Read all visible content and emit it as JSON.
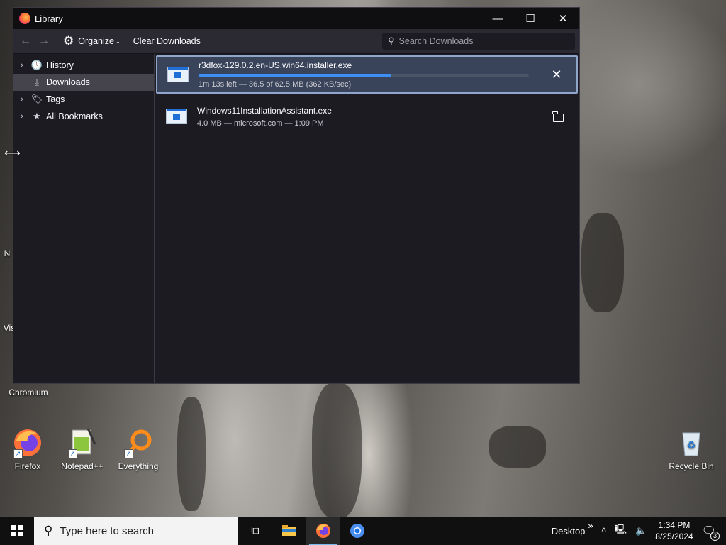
{
  "window": {
    "title": "Library",
    "controls": {
      "minimize": "—",
      "maximize": "☐",
      "close": "✕"
    }
  },
  "toolbar": {
    "back": "←",
    "forward": "→",
    "organize_label": "Organize",
    "organize_caret": "⌄",
    "clear_label": "Clear Downloads",
    "search_placeholder": "Search Downloads"
  },
  "sidebar": {
    "items": [
      {
        "label": "History",
        "twisty": "›",
        "icon": "history-icon",
        "selected": false
      },
      {
        "label": "Downloads",
        "twisty": "",
        "icon": "download-icon",
        "selected": true
      },
      {
        "label": "Tags",
        "twisty": "›",
        "icon": "tags-icon",
        "selected": false
      },
      {
        "label": "All Bookmarks",
        "twisty": "›",
        "icon": "star-icon",
        "selected": false
      }
    ]
  },
  "downloads": [
    {
      "name": "r3dfox-129.0.2.en-US.win64.installer.exe",
      "status": "1m 13s left — 36.5 of 62.5 MB (362 KB/sec)",
      "progress": 0.584,
      "action": "cancel",
      "action_glyph": "✕"
    },
    {
      "name": "Windows11InstallationAssistant.exe",
      "status": "4.0 MB — microsoft.com — 1:09 PM",
      "action": "open-folder"
    }
  ],
  "desktop_icons": {
    "chromium": "Chromium",
    "firefox": "Firefox",
    "notepadpp": "Notepad++",
    "everything": "Everything",
    "recycle": "Recycle Bin",
    "partial_1": "N",
    "partial_2": "Vis"
  },
  "taskbar": {
    "search_placeholder": "Type here to search",
    "desktop_label": "Desktop",
    "overflow": "»",
    "time": "1:34 PM",
    "date": "8/25/2024",
    "notification_count": "3"
  },
  "colors": {
    "window_bg": "#1c1b22",
    "toolbar_bg": "#2b2a33",
    "progress": "#3d8ef5",
    "active_row": "#39445a"
  }
}
